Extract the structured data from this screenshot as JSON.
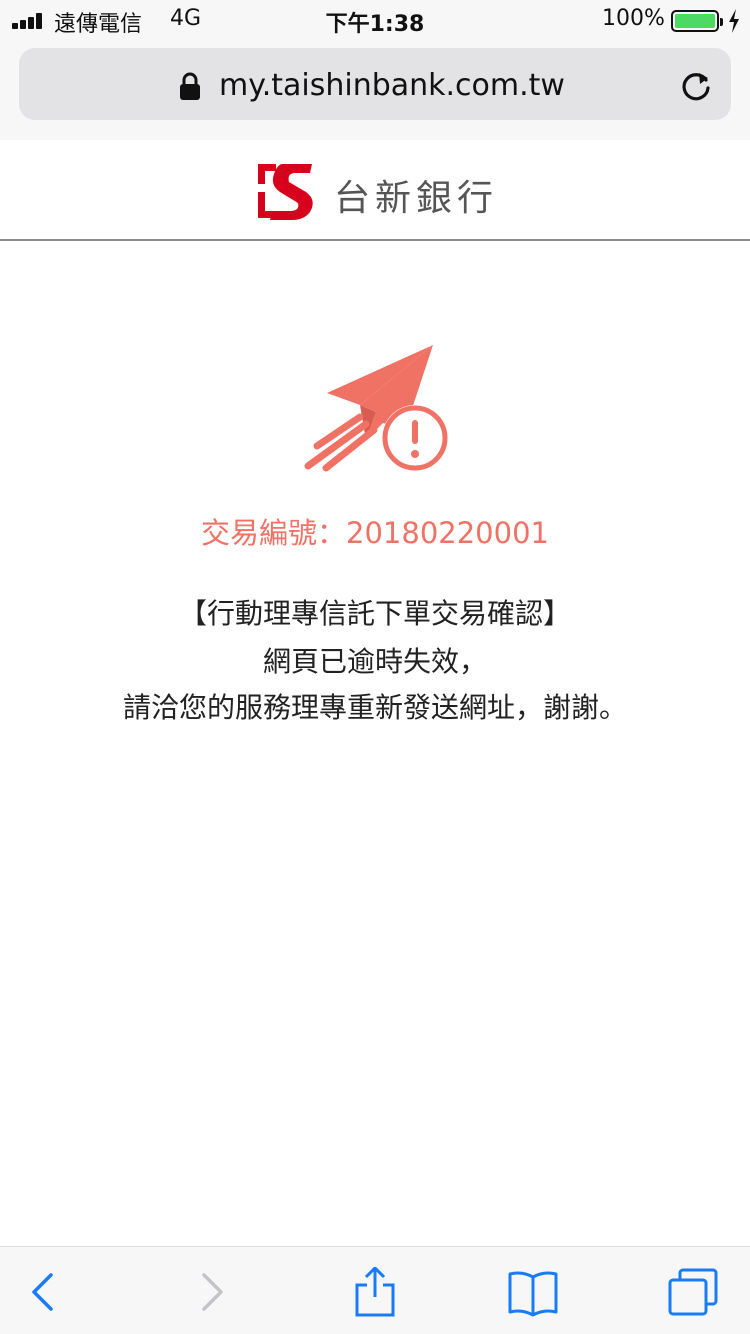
{
  "status_bar": {
    "carrier": "遠傳電信",
    "network": "4G",
    "time": "下午1:38",
    "battery": "100%",
    "battery_color": "#4cd964"
  },
  "browser": {
    "url": "my.taishinbank.com.tw",
    "lock_icon": "lock-icon",
    "reload_icon": "reload-icon"
  },
  "site": {
    "brand": "台新銀行",
    "brand_color": "#d7001d",
    "logo_icon": "taishin-logo-icon"
  },
  "content": {
    "alert_icon": "paper-plane-alert-icon",
    "accent_color": "#f07265",
    "transaction_number": "交易編號：20180220001",
    "message_line1": "【行動理專信託下單交易確認】",
    "message_line2": "網頁已逾時失效，",
    "message_line3": "請洽您的服務理專重新發送網址，謝謝。"
  },
  "toolbar": {
    "icons": [
      "back-icon",
      "forward-icon",
      "share-icon",
      "bookmarks-icon",
      "tabs-icon"
    ],
    "active_color": "#1a7cf5",
    "disabled_color": "#c4c4c8"
  }
}
